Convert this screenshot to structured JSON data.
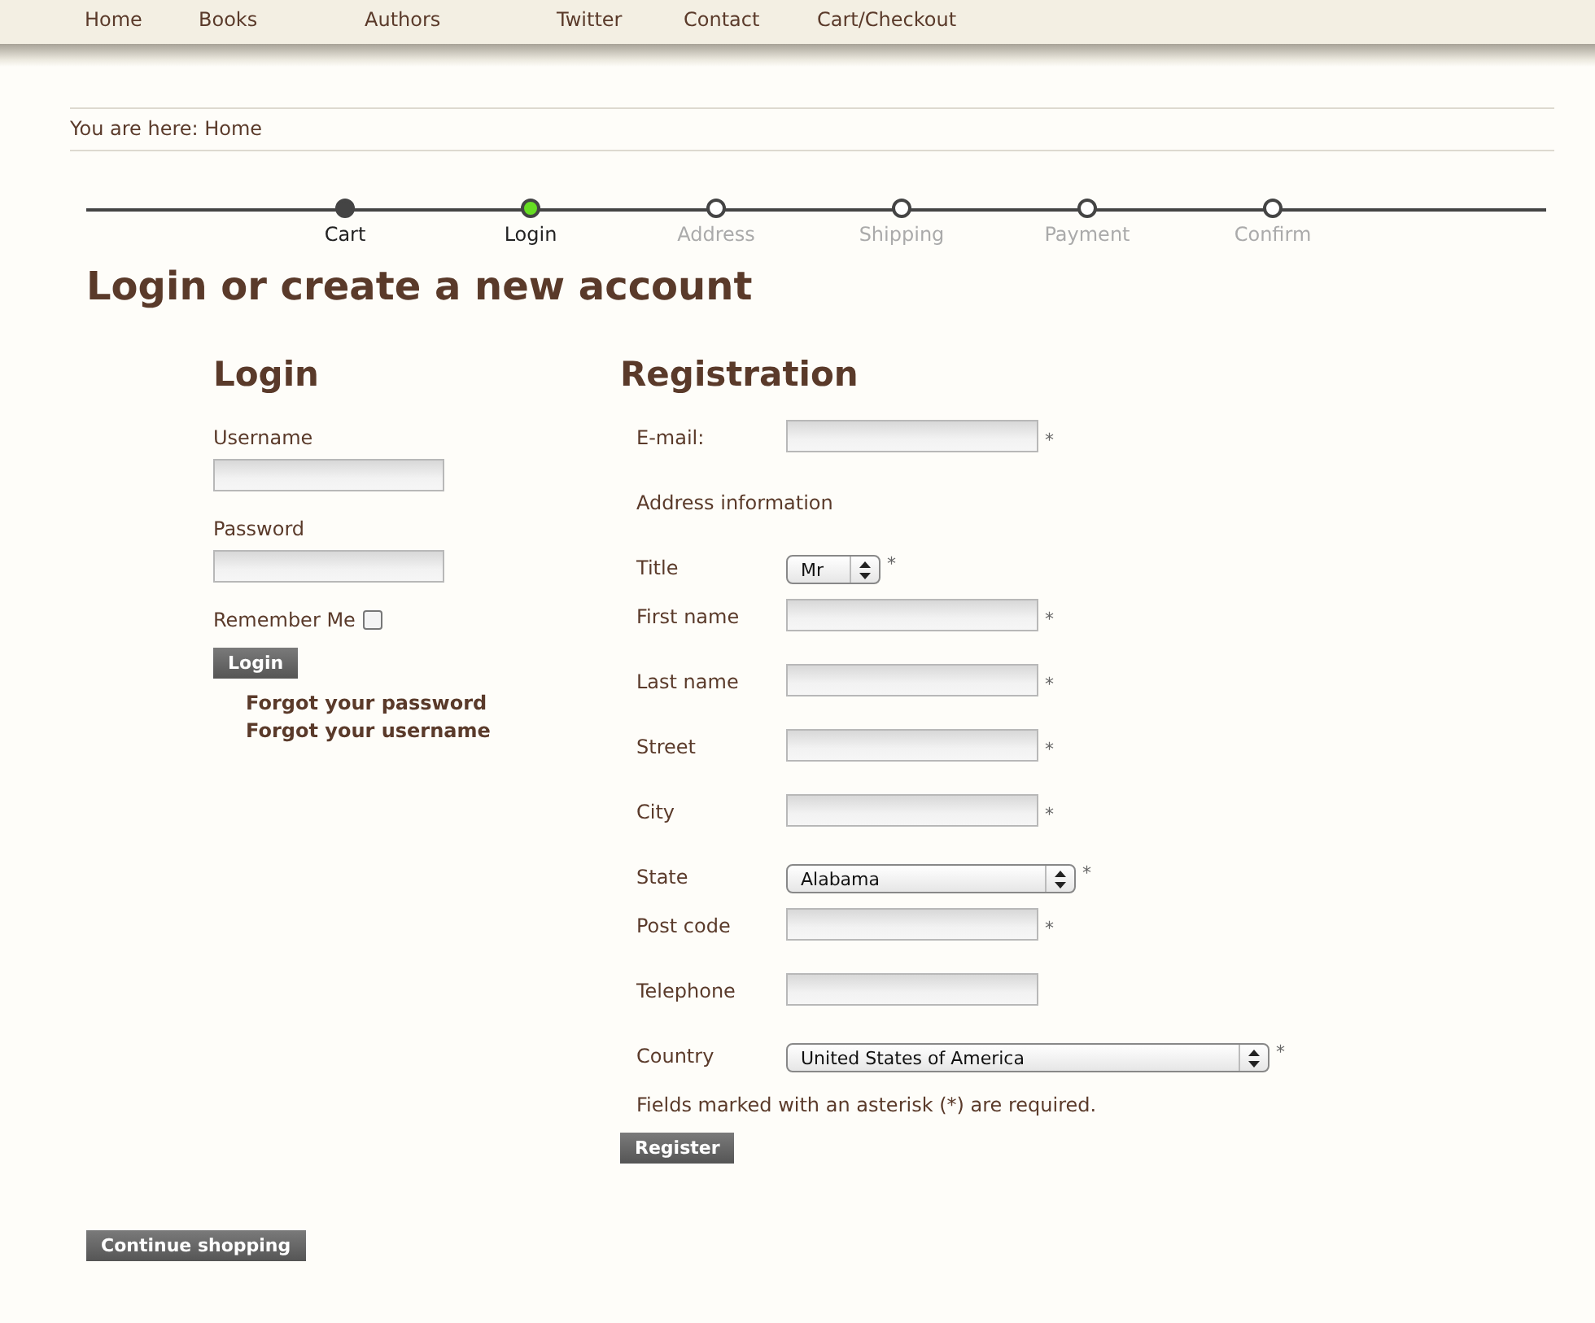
{
  "nav": [
    "Home",
    "Books",
    "Authors",
    "Twitter",
    "Contact",
    "Cart/Checkout"
  ],
  "breadcrumb": {
    "prefix": "You are here:",
    "current": "Home"
  },
  "steps": [
    {
      "label": "Cart",
      "kind": "done"
    },
    {
      "label": "Login",
      "kind": "current"
    },
    {
      "label": "Address",
      "kind": "upcoming"
    },
    {
      "label": "Shipping",
      "kind": "upcoming"
    },
    {
      "label": "Payment",
      "kind": "upcoming"
    },
    {
      "label": "Confirm",
      "kind": "upcoming"
    }
  ],
  "page_title": "Login or create a new account",
  "login": {
    "heading": "Login",
    "username_label": "Username",
    "password_label": "Password",
    "remember_label": "Remember Me",
    "remember_checked": false,
    "button": "Login",
    "links": [
      "Forgot your password",
      "Forgot your username"
    ]
  },
  "registration": {
    "heading": "Registration",
    "rows": [
      {
        "kind": "text",
        "label": "E-mail:",
        "required": true
      },
      {
        "kind": "section",
        "label": "Address information"
      },
      {
        "kind": "shortselect",
        "label": "Title",
        "value": "Mr",
        "required": true
      },
      {
        "kind": "text",
        "label": "First name",
        "required": true
      },
      {
        "kind": "text",
        "label": "Last name",
        "required": true
      },
      {
        "kind": "text",
        "label": "Street",
        "required": true
      },
      {
        "kind": "text",
        "label": "City",
        "required": true
      },
      {
        "kind": "select",
        "label": "State",
        "value": "Alabama",
        "required": true
      },
      {
        "kind": "text",
        "label": "Post code",
        "required": true
      },
      {
        "kind": "text",
        "label": "Telephone",
        "required": false
      },
      {
        "kind": "wideselect",
        "label": "Country",
        "value": "United States of America",
        "required": true
      }
    ],
    "required_mark": "*",
    "note": "Fields marked with an asterisk (*) are required.",
    "button": "Register"
  },
  "continue_button": "Continue shopping"
}
